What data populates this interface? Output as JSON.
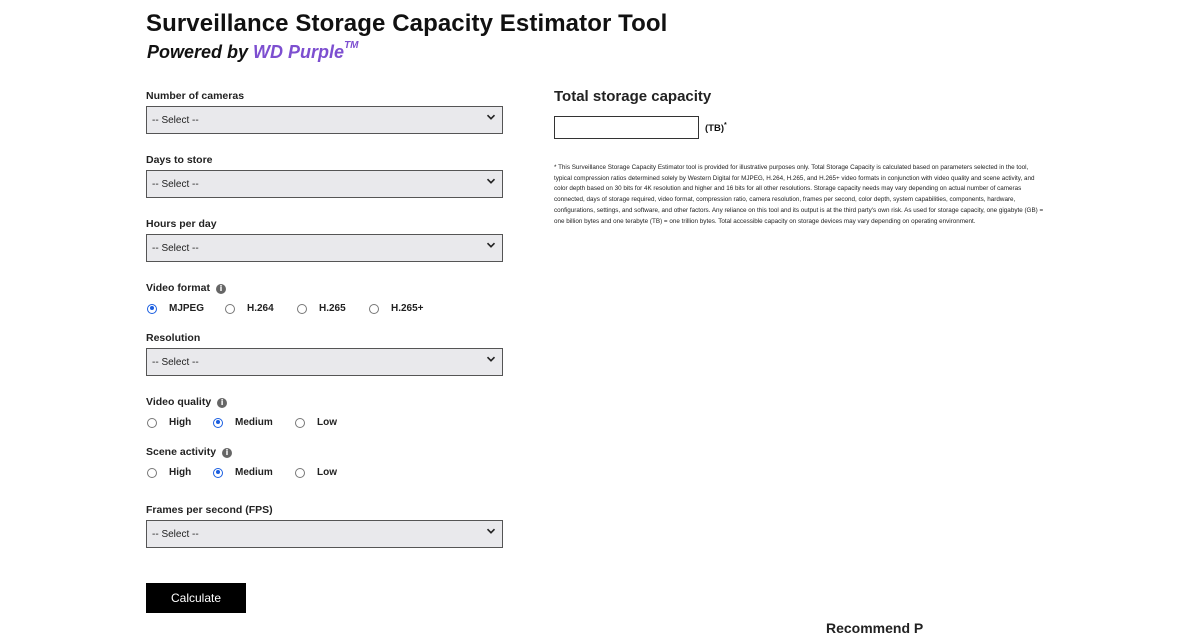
{
  "header": {
    "title": "Surveillance Storage Capacity Estimator Tool",
    "powered_prefix": "Powered by",
    "brand": "WD Purple",
    "trademark": "TM"
  },
  "form": {
    "cameras": {
      "label": "Number of cameras",
      "value": "-- Select --"
    },
    "days": {
      "label": "Days to store",
      "value": "-- Select --"
    },
    "hours": {
      "label": "Hours per day",
      "value": "-- Select --"
    },
    "video_format": {
      "label": "Video format",
      "options": [
        "MJPEG",
        "H.264",
        "H.265",
        "H.265+"
      ],
      "selected": "MJPEG"
    },
    "resolution": {
      "label": "Resolution",
      "value": "-- Select --"
    },
    "video_quality": {
      "label": "Video quality",
      "options": [
        "High",
        "Medium",
        "Low"
      ],
      "selected": "Medium"
    },
    "scene_activity": {
      "label": "Scene activity",
      "options": [
        "High",
        "Medium",
        "Low"
      ],
      "selected": "Medium"
    },
    "fps": {
      "label": "Frames per second (FPS)",
      "value": "-- Select --"
    },
    "calculate_label": "Calculate"
  },
  "result": {
    "title": "Total storage capacity",
    "value": "",
    "unit": "(TB)",
    "asterisk": "*",
    "disclaimer": "* This Surveillance Storage Capacity Estimator tool is provided for illustrative purposes only. Total Storage Capacity is calculated based on parameters selected in the tool, typical compression ratios determined solely by Western Digital for MJPEG, H.264, H.265, and H.265+ video formats in conjunction with video quality and scene activity, and color depth based on 30 bits for 4K resolution and higher and 16 bits for all other resolutions. Storage capacity needs may vary depending on actual number of cameras connected, days of storage required, video format, compression ratio, camera resolution, frames per second, color depth, system capabilities, components, hardware, configurations, settings, and software, and other factors. Any reliance on this tool and its output is at the third party's own risk. As used for storage capacity, one gigabyte (GB) = one billion bytes and one terabyte (TB) = one trillion bytes. Total accessible capacity on storage devices may vary depending on operating environment."
  },
  "footer_partial_text": "Recommend P",
  "icons": {
    "info": "info-icon",
    "dropdown": "chevron-down-icon"
  },
  "colors": {
    "brand": "#7d4fd0",
    "radio_selected": "#1a5ee0",
    "select_bg": "#e9e9ec",
    "button_bg": "#000000"
  }
}
